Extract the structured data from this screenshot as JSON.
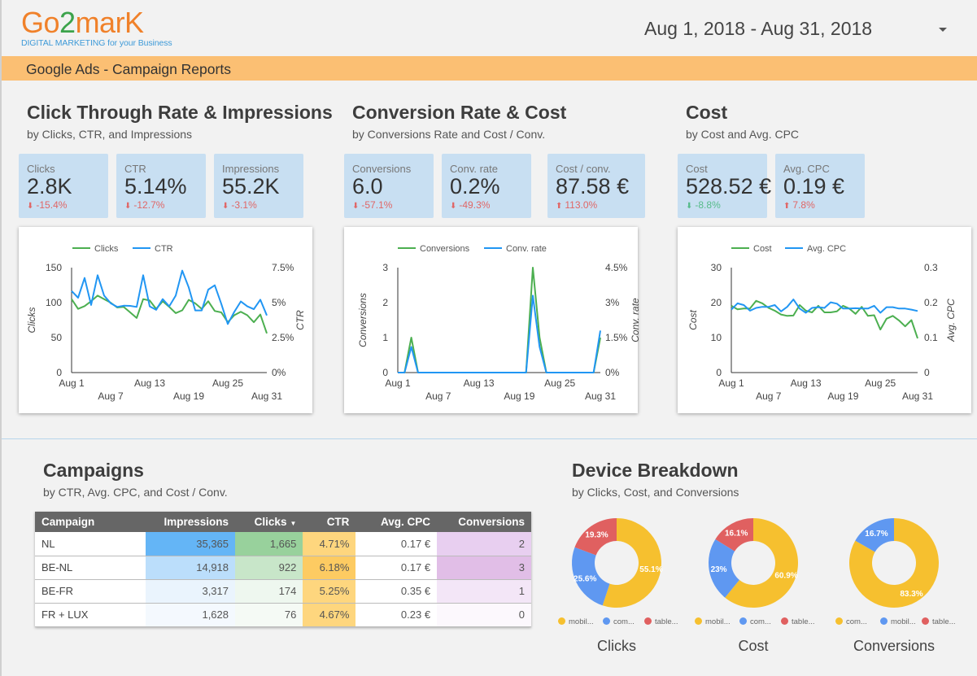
{
  "header": {
    "logo_part1": "Go",
    "logo_part2": "2",
    "logo_part3": "marK",
    "logo_tagline": "DIGITAL MARKETING for your Business",
    "date_range": "Aug 1, 2018 - Aug 31, 2018",
    "report_title": "Google Ads - Campaign Reports"
  },
  "colors": {
    "banner": "#fbbf73",
    "kpi_bg": "#c8dff2",
    "series_green": "#4caf50",
    "series_blue": "#2196f3",
    "negative": "#e06666",
    "positive": "#57bb8a",
    "donut_yellow": "#f6c02f",
    "donut_blue": "#5f98f1",
    "donut_red": "#e06060"
  },
  "sections": {
    "ctr": {
      "title": "Click Through Rate & Impressions",
      "subtitle": "by Clicks, CTR, and Impressions"
    },
    "conv": {
      "title": "Conversion Rate & Cost",
      "subtitle": "by Conversions Rate and Cost / Conv."
    },
    "cost": {
      "title": "Cost",
      "subtitle": "by Cost and Avg. CPC"
    },
    "campaigns": {
      "title": "Campaigns",
      "subtitle": "by CTR, Avg. CPC, and Cost / Conv."
    },
    "device": {
      "title": "Device Breakdown",
      "subtitle": "by Clicks, Cost, and Conversions"
    }
  },
  "kpis": [
    {
      "label": "Clicks",
      "value": "2.8K",
      "delta": "-15.4%",
      "direction": "down",
      "sentiment": "negative"
    },
    {
      "label": "CTR",
      "value": "5.14%",
      "delta": "-12.7%",
      "direction": "down",
      "sentiment": "negative"
    },
    {
      "label": "Impressions",
      "value": "55.2K",
      "delta": "-3.1%",
      "direction": "down",
      "sentiment": "negative"
    },
    {
      "label": "Conversions",
      "value": "6.0",
      "delta": "-57.1%",
      "direction": "down",
      "sentiment": "negative"
    },
    {
      "label": "Conv. rate",
      "value": "0.2%",
      "delta": "-49.3%",
      "direction": "down",
      "sentiment": "negative"
    },
    {
      "label": "Cost / conv.",
      "value": "87.58 €",
      "delta": "113.0%",
      "direction": "up",
      "sentiment": "negative"
    },
    {
      "label": "Cost",
      "value": "528.52 €",
      "delta": "-8.8%",
      "direction": "down",
      "sentiment": "positive"
    },
    {
      "label": "Avg. CPC",
      "value": "0.19 €",
      "delta": "7.8%",
      "direction": "up",
      "sentiment": "negative"
    }
  ],
  "chart_data": [
    {
      "type": "line",
      "id": "clicks-ctr",
      "x_tick_labels_row1": [
        "Aug 1",
        "Aug 13",
        "Aug 25"
      ],
      "x_tick_labels_row2": [
        "Aug 7",
        "Aug 19",
        "Aug 31"
      ],
      "x": [
        "Aug 1",
        "Aug 2",
        "Aug 3",
        "Aug 4",
        "Aug 5",
        "Aug 6",
        "Aug 7",
        "Aug 8",
        "Aug 9",
        "Aug 10",
        "Aug 11",
        "Aug 12",
        "Aug 13",
        "Aug 14",
        "Aug 15",
        "Aug 16",
        "Aug 17",
        "Aug 18",
        "Aug 19",
        "Aug 20",
        "Aug 21",
        "Aug 22",
        "Aug 23",
        "Aug 24",
        "Aug 25",
        "Aug 26",
        "Aug 27",
        "Aug 28",
        "Aug 29",
        "Aug 30",
        "Aug 31"
      ],
      "ylabel_left": "Clicks",
      "ylabel_right": "CTR",
      "ylim_left": [
        0,
        150
      ],
      "ylim_right": [
        0,
        7.5
      ],
      "yticks_left": [
        "0",
        "50",
        "100",
        "150"
      ],
      "yticks_right": [
        "0%",
        "2.5%",
        "5%",
        "7.5%"
      ],
      "legend_position": "top-left",
      "series": [
        {
          "name": "Clicks",
          "axis": "left",
          "color": "#4caf50",
          "values": [
            105,
            91,
            95,
            102,
            110,
            105,
            100,
            93,
            94,
            86,
            78,
            105,
            103,
            91,
            102,
            94,
            85,
            89,
            104,
            99,
            91,
            102,
            88,
            86,
            72,
            82,
            87,
            82,
            72,
            83,
            56
          ]
        },
        {
          "name": "CTR",
          "axis": "right",
          "color": "#2196f3",
          "values": [
            5.83,
            5.35,
            6.76,
            4.83,
            6.96,
            5.5,
            4.96,
            4.69,
            4.78,
            4.77,
            4.69,
            6.96,
            4.73,
            4.48,
            5.25,
            4.73,
            5.5,
            7.29,
            6.09,
            4.44,
            4.44,
            5.93,
            6.24,
            4.92,
            3.47,
            4.34,
            5.08,
            4.73,
            4.53,
            5.21,
            4.09
          ]
        }
      ]
    },
    {
      "type": "line",
      "id": "conversions-rate",
      "x_tick_labels_row1": [
        "Aug 1",
        "Aug 13",
        "Aug 25"
      ],
      "x_tick_labels_row2": [
        "Aug 7",
        "Aug 19",
        "Aug 31"
      ],
      "ylabel_left": "Conversions",
      "ylabel_right": "Conv. rate",
      "ylim_left": [
        0,
        3
      ],
      "ylim_right": [
        0,
        4.5
      ],
      "yticks_left": [
        "0",
        "1",
        "2",
        "3"
      ],
      "yticks_right": [
        "0%",
        "1.5%",
        "3%",
        "4.5%"
      ],
      "legend_position": "top-left",
      "series": [
        {
          "name": "Conversions",
          "axis": "left",
          "color": "#4caf50",
          "values": [
            0,
            0,
            1,
            0,
            0,
            0,
            0,
            0,
            0,
            0,
            0,
            0,
            0,
            0,
            0,
            0,
            0,
            0,
            0,
            0,
            3,
            1,
            0,
            0,
            0,
            0,
            0,
            0,
            0,
            0,
            1
          ]
        },
        {
          "name": "Conv. rate",
          "axis": "right",
          "color": "#2196f3",
          "values": [
            0,
            0,
            1.1,
            0,
            0,
            0,
            0,
            0,
            0,
            0,
            0,
            0,
            0,
            0,
            0,
            0,
            0,
            0,
            0,
            0,
            3.3,
            1.1,
            0,
            0,
            0,
            0,
            0,
            0,
            0,
            0,
            1.8
          ]
        }
      ]
    },
    {
      "type": "line",
      "id": "cost-cpc",
      "x_tick_labels_row1": [
        "Aug 1",
        "Aug 13",
        "Aug 25"
      ],
      "x_tick_labels_row2": [
        "Aug 7",
        "Aug 19",
        "Aug 31"
      ],
      "ylabel_left": "Cost",
      "ylabel_right": "Avg. CPC",
      "ylim_left": [
        0,
        30
      ],
      "ylim_right": [
        0,
        0.3
      ],
      "yticks_left": [
        "0",
        "10",
        "20",
        "30"
      ],
      "yticks_right": [
        "0",
        "0.1",
        "0.2",
        "0.3"
      ],
      "legend_position": "top-left",
      "series": [
        {
          "name": "Cost",
          "axis": "left",
          "color": "#4caf50",
          "values": [
            19.1,
            18.1,
            18.3,
            18.3,
            20.5,
            19.8,
            18.5,
            17.7,
            16.6,
            16.2,
            16.3,
            19.3,
            17.7,
            17.2,
            19.1,
            17.2,
            17.2,
            17.5,
            19.1,
            18.3,
            16.8,
            18.8,
            16.2,
            16.4,
            12.3,
            15.4,
            16.2,
            14.9,
            13.2,
            15.0,
            9.8
          ]
        },
        {
          "name": "Avg. CPC",
          "axis": "right",
          "color": "#2196f3",
          "values": [
            0.18,
            0.198,
            0.193,
            0.177,
            0.185,
            0.188,
            0.188,
            0.193,
            0.175,
            0.188,
            0.209,
            0.183,
            0.171,
            0.185,
            0.187,
            0.185,
            0.201,
            0.197,
            0.183,
            0.183,
            0.184,
            0.183,
            0.183,
            0.191,
            0.171,
            0.187,
            0.187,
            0.183,
            0.183,
            0.18,
            0.176
          ]
        }
      ]
    },
    {
      "type": "table",
      "id": "campaigns",
      "columns": [
        "Campaign",
        "Impressions",
        "Clicks",
        "CTR",
        "Avg. CPC",
        "Conversions"
      ],
      "sorted_column": "Clicks",
      "sort_direction": "descending",
      "rows": [
        [
          "NL",
          "35,365",
          "1,665",
          "4.71%",
          "0.17 €",
          "2"
        ],
        [
          "BE-NL",
          "14,918",
          "922",
          "6.18%",
          "0.17 €",
          "3"
        ],
        [
          "BE-FR",
          "3,317",
          "174",
          "5.25%",
          "0.35 €",
          "1"
        ],
        [
          "FR + LUX",
          "1,628",
          "76",
          "4.67%",
          "0.23 €",
          "0"
        ]
      ],
      "heatmap_colors": [
        [
          "#ffffff",
          "#64b5f6",
          "#98d19c",
          "#fed67e",
          "#ffffff",
          "#e8cff0"
        ],
        [
          "#ffffff",
          "#bbdefb",
          "#c8e6c9",
          "#fdcb62",
          "#ffffff",
          "#e1bee7"
        ],
        [
          "#ffffff",
          "#eaf4fd",
          "#eef7ef",
          "#fed67e",
          "#ffffff",
          "#f3e6f7"
        ],
        [
          "#ffffff",
          "#f4f9fe",
          "#f5faf5",
          "#fed67e",
          "#ffffff",
          "#fcf8fd"
        ]
      ]
    },
    {
      "type": "pie",
      "id": "device-clicks",
      "title": "Clicks",
      "slices": [
        {
          "label": "mobil...",
          "value": 55.1,
          "display": "55.1%",
          "color": "#f6c02f"
        },
        {
          "label": "com...",
          "value": 25.6,
          "display": "25.6%",
          "color": "#5f98f1"
        },
        {
          "label": "table...",
          "value": 19.3,
          "display": "19.3%",
          "color": "#e06060"
        }
      ]
    },
    {
      "type": "pie",
      "id": "device-cost",
      "title": "Cost",
      "slices": [
        {
          "label": "mobil...",
          "value": 60.9,
          "display": "60.9%",
          "color": "#f6c02f"
        },
        {
          "label": "com...",
          "value": 23.0,
          "display": "23%",
          "color": "#5f98f1"
        },
        {
          "label": "table...",
          "value": 16.1,
          "display": "16.1%",
          "color": "#e06060"
        }
      ]
    },
    {
      "type": "pie",
      "id": "device-conversions",
      "title": "Conversions",
      "slices": [
        {
          "label": "com...",
          "value": 83.3,
          "display": "83.3%",
          "color": "#f6c02f"
        },
        {
          "label": "mobil...",
          "value": 16.7,
          "display": "16.7%",
          "color": "#5f98f1"
        },
        {
          "label": "table...",
          "value": 0,
          "display": "",
          "color": "#e06060"
        }
      ]
    }
  ]
}
